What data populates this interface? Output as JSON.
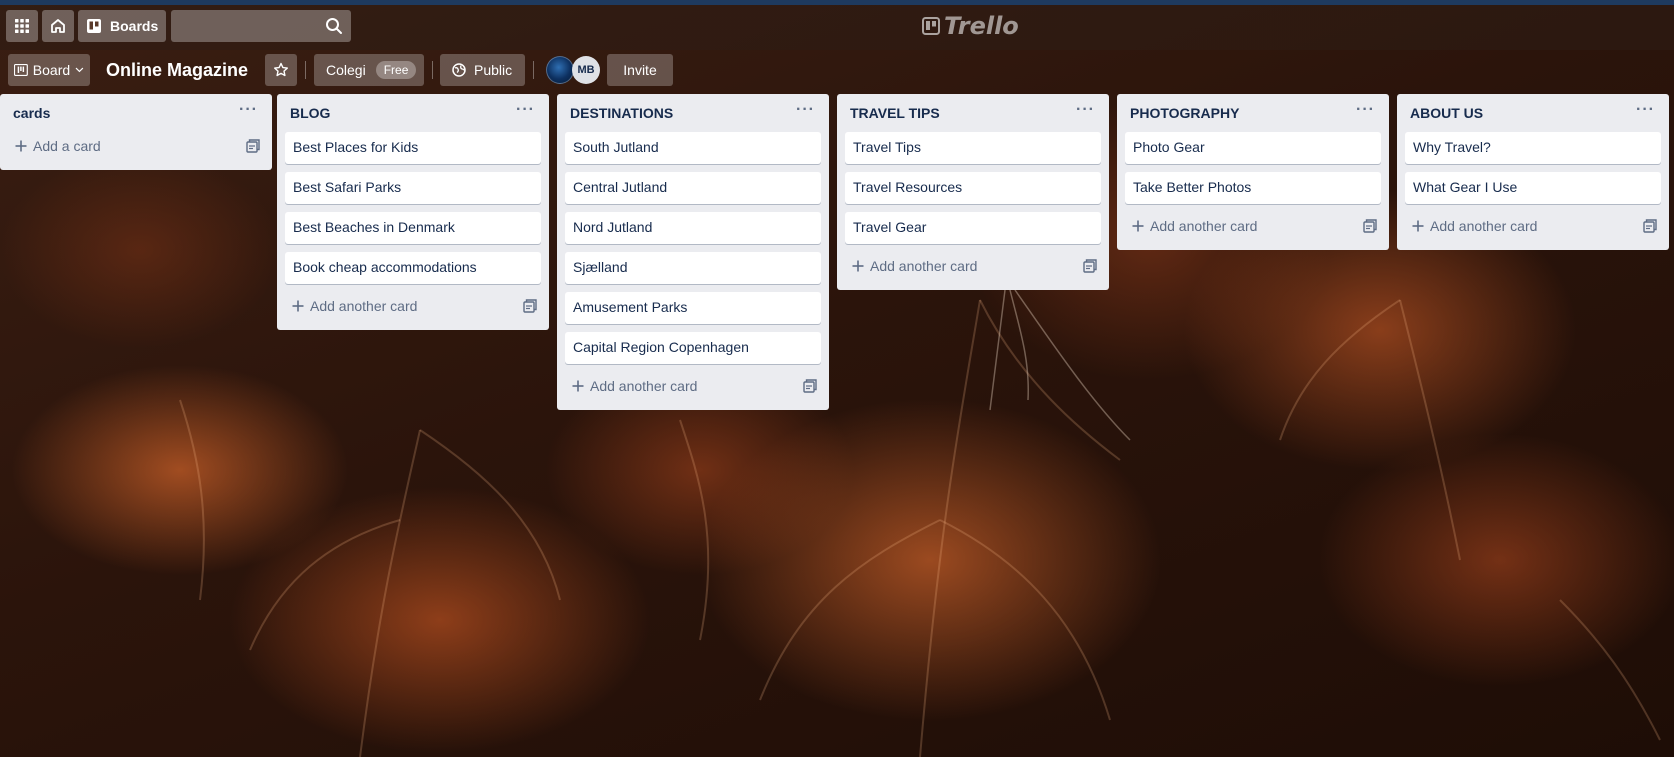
{
  "app": {
    "logo_text": "Trello",
    "brand_color": "#1e3a5f"
  },
  "topbar": {
    "boards_label": "Boards",
    "search_value": "",
    "search_placeholder": ""
  },
  "boardbar": {
    "view_label": "Board",
    "board_title": "Online Magazine",
    "workspace_name": "Colegi",
    "workspace_badge": "Free",
    "visibility_label": "Public",
    "member_initials": "MB",
    "invite_label": "Invite"
  },
  "lists": [
    {
      "title": "cards",
      "cards": [],
      "add_label": "Add a card"
    },
    {
      "title": "BLOG",
      "cards": [
        "Best Places for Kids",
        "Best Safari Parks",
        "Best Beaches in Denmark",
        "Book cheap accommodations"
      ],
      "add_label": "Add another card"
    },
    {
      "title": "DESTINATIONS",
      "cards": [
        "South Jutland",
        "Central Jutland",
        "Nord Jutland",
        "Sjælland",
        "Amusement Parks",
        "Capital Region Copenhagen"
      ],
      "add_label": "Add another card"
    },
    {
      "title": "TRAVEL TIPS",
      "cards": [
        "Travel Tips",
        "Travel Resources",
        "Travel Gear"
      ],
      "add_label": "Add another card"
    },
    {
      "title": "PHOTOGRAPHY",
      "cards": [
        "Photo Gear",
        "Take Better Photos"
      ],
      "add_label": "Add another card"
    },
    {
      "title": "ABOUT US",
      "cards": [
        "Why Travel?",
        "What Gear I Use"
      ],
      "add_label": "Add another card"
    }
  ]
}
